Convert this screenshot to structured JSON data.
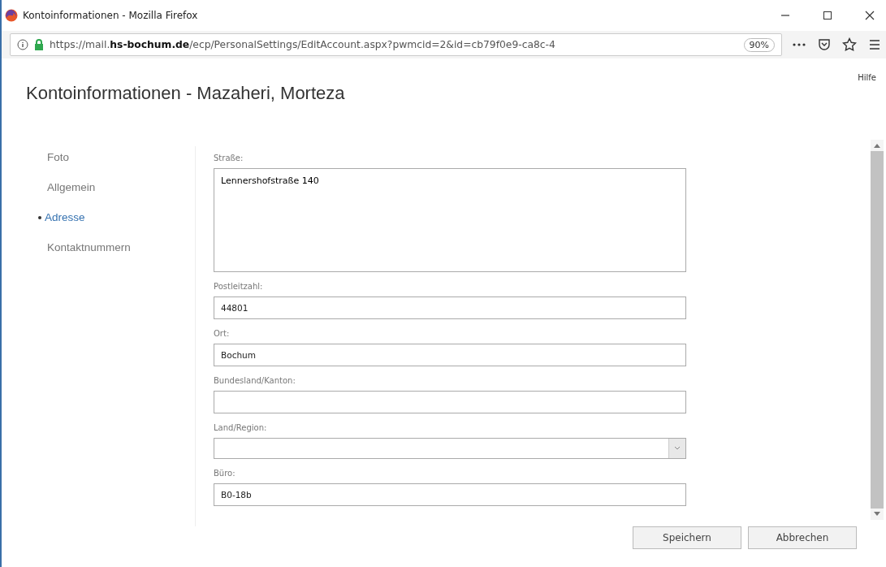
{
  "window": {
    "title": "Kontoinformationen - Mozilla Firefox"
  },
  "address_bar": {
    "url": "https://mail.**hs-bochum.de**/ecp/PersonalSettings/EditAccount.aspx?pwmcid=2&id=cb79f0e9-ca8c-4",
    "zoom": "90%"
  },
  "help_link": "Hilfe",
  "page_title": "Kontoinformationen - Mazaheri, Morteza",
  "sidebar": {
    "items": [
      {
        "label": "Foto",
        "selected": false
      },
      {
        "label": "Allgemein",
        "selected": false
      },
      {
        "label": "Adresse",
        "selected": true
      },
      {
        "label": "Kontaktnummern",
        "selected": false
      }
    ]
  },
  "form": {
    "fields": [
      {
        "kind": "textarea",
        "label": "Straße:",
        "value": "Lennershofstraße 140"
      },
      {
        "kind": "text",
        "label": "Postleitzahl:",
        "value": "44801"
      },
      {
        "kind": "text",
        "label": "Ort:",
        "value": "Bochum"
      },
      {
        "kind": "text",
        "label": "Bundesland/Kanton:"
      },
      {
        "kind": "select",
        "label": "Land/Region:"
      },
      {
        "kind": "text",
        "label": "Büro:",
        "value": "B0-18b"
      }
    ]
  },
  "buttons": [
    "Speichern",
    "Abbrechen"
  ]
}
